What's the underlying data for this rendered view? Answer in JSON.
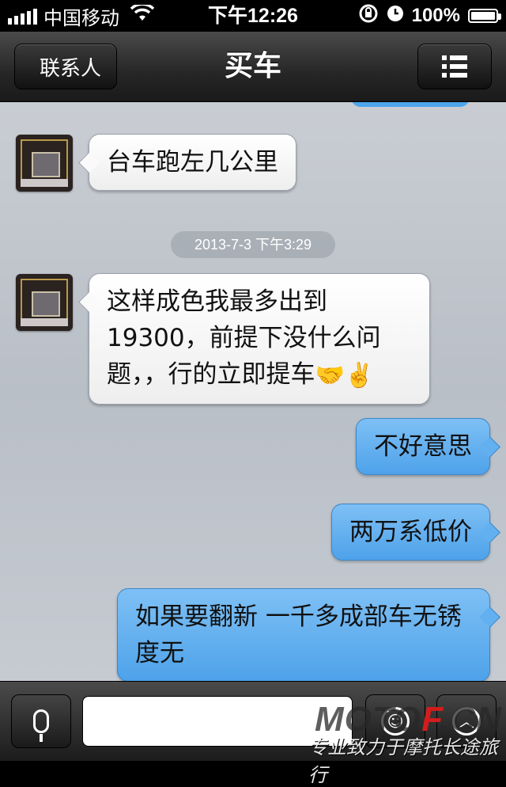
{
  "status_bar": {
    "carrier": "中国移动",
    "time": "下午12:26",
    "battery": "100%"
  },
  "nav": {
    "back_label": "联系人",
    "title": "买车"
  },
  "messages": [
    {
      "side": "left",
      "text": "台车跑左几公里"
    },
    {
      "side": "left",
      "text": "这样成色我最多出到19300，前提下没什么问题，，行的立即提车",
      "emojis": [
        "🤝",
        "✌️"
      ]
    },
    {
      "side": "right",
      "text": "不好意思"
    },
    {
      "side": "right",
      "text": "两万系低价"
    },
    {
      "side": "right",
      "text": "如果要翻新 一千多成部车无锈度无"
    }
  ],
  "timestamp": "2013-7-3 下午3:29",
  "input": {
    "placeholder": "",
    "value": ""
  },
  "watermark": {
    "logo_left": "MOTO",
    "logo_red": "F",
    "logo_right": ".CN",
    "tagline": "专业致力于摩托长途旅行"
  },
  "colors": {
    "outgoing_bubble": "#4ea2ea",
    "incoming_bubble": "#ffffff",
    "chat_background": "#c0c5cc"
  }
}
